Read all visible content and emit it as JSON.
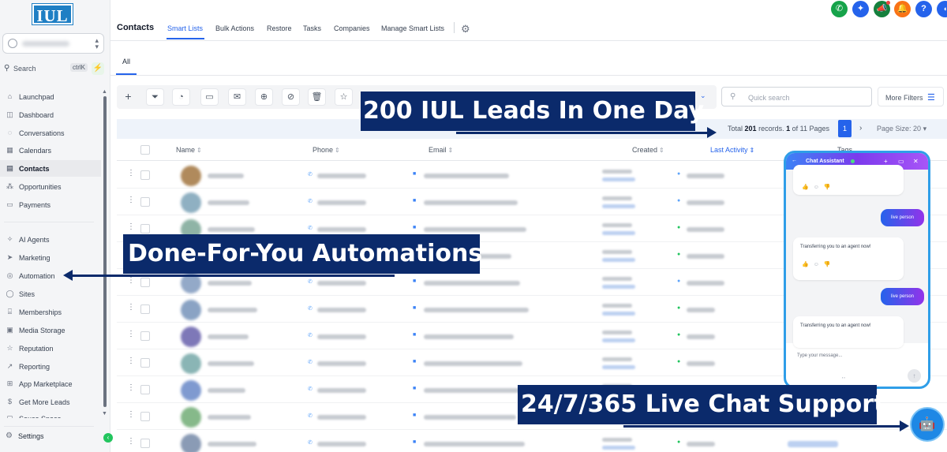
{
  "app": {
    "logo_text": "IUL"
  },
  "sidebar": {
    "search_label": "Search",
    "search_shortcut": "ctrlK",
    "items": [
      {
        "label": "Launchpad",
        "icon": "rocket-icon"
      },
      {
        "label": "Dashboard",
        "icon": "gauge-icon"
      },
      {
        "label": "Conversations",
        "icon": "chat-icon"
      },
      {
        "label": "Calendars",
        "icon": "calendar-icon"
      },
      {
        "label": "Contacts",
        "icon": "contacts-icon"
      },
      {
        "label": "Opportunities",
        "icon": "funnel-icon"
      },
      {
        "label": "Payments",
        "icon": "receipt-icon"
      },
      {
        "label": "AI Agents",
        "icon": "sparkle-icon"
      },
      {
        "label": "Marketing",
        "icon": "send-icon"
      },
      {
        "label": "Automation",
        "icon": "automation-icon"
      },
      {
        "label": "Sites",
        "icon": "globe-icon"
      },
      {
        "label": "Memberships",
        "icon": "graduation-icon"
      },
      {
        "label": "Media Storage",
        "icon": "image-icon"
      },
      {
        "label": "Reputation",
        "icon": "star-icon"
      },
      {
        "label": "Reporting",
        "icon": "chart-icon"
      },
      {
        "label": "App Marketplace",
        "icon": "grid-icon"
      },
      {
        "label": "Get More Leads",
        "icon": "dollar-icon"
      },
      {
        "label": "Sauce Space",
        "icon": "folder-icon"
      }
    ],
    "active": "Contacts",
    "settings_label": "Settings"
  },
  "header": {
    "title": "Contacts",
    "tabs": [
      "Smart Lists",
      "Bulk Actions",
      "Restore",
      "Tasks",
      "Companies",
      "Manage Smart Lists"
    ],
    "active_tab": "Smart Lists"
  },
  "subtab": {
    "label": "All"
  },
  "toolbar": {
    "quick_search_placeholder": "Quick search",
    "more_filters_label": "More Filters"
  },
  "pagination": {
    "total_prefix": "Total",
    "total_records": "201",
    "records_suffix": "records.",
    "current_page": "1",
    "of_pages": "of 11 Pages",
    "page_button": "1",
    "page_size_label": "Page Size: 20"
  },
  "table": {
    "columns": [
      "Name",
      "Phone",
      "Email",
      "Created",
      "Last Activity",
      "Tags"
    ],
    "sorted_column": "Last Activity"
  },
  "annotations": {
    "leads": "200 IUL Leads In One Day",
    "automations": "Done-For-You Automations",
    "support": "24/7/365 Live Chat Support"
  },
  "chat": {
    "title": "Chat Assistant",
    "user_msg": "live person",
    "bot_msg": "Transferring you to an agent now!",
    "input_placeholder": "Type your message..."
  },
  "colors": {
    "accent": "#2563eb",
    "annotation_bg": "#0b2a6b",
    "logo_bg": "#1f7fc4",
    "chat_border": "#2f9ee8"
  }
}
